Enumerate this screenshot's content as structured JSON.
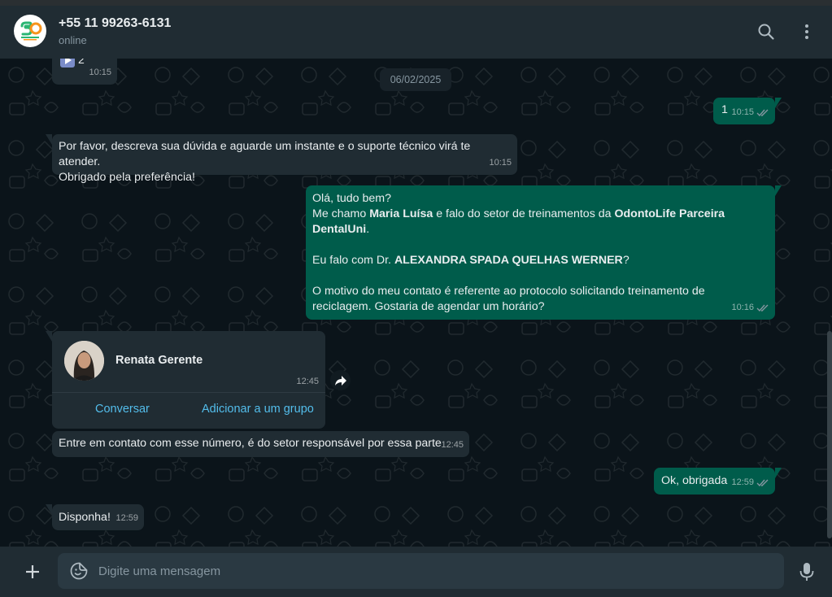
{
  "header": {
    "contact_name": "+55 11 99263-6131",
    "status": "online",
    "avatar_icon": "sd-logo-icon",
    "search_icon": "search-icon",
    "menu_icon": "kebab-menu-icon"
  },
  "chat": {
    "date_separator": "06/02/2025",
    "top_partial": {
      "option_number": "2",
      "option_icon": "play-icon",
      "time": "10:15"
    },
    "messages": [
      {
        "dir": "out",
        "text": "1",
        "time": "10:15",
        "status": "read"
      },
      {
        "dir": "in",
        "line1": "Por favor, descreva sua dúvida e aguarde um instante e o suporte técnico virá te atender.",
        "line2": "Obrigado pela preferência!",
        "time": "10:15"
      },
      {
        "dir": "out",
        "time": "10:16",
        "status": "read",
        "l1": "Olá, tudo bem?",
        "l2a": "Me chamo ",
        "l2b": "Maria Luísa",
        "l2c": " e falo do setor de treinamentos da ",
        "l2d": "OdontoLife Parceira",
        "l3a": "DentalUni",
        "l3b": ".",
        "l4a": "Eu falo com Dr. ",
        "l4b": "ALEXANDRA SPADA QUELHAS WERNER",
        "l4c": "?",
        "l5": "O motivo do meu contato é referente ao protocolo solicitando treinamento de",
        "l6": "reciclagem. Gostaria de agendar um horário?"
      },
      {
        "dir": "in",
        "type": "contact",
        "contact_name": "Renata Gerente",
        "time": "12:45",
        "action_chat": "Conversar",
        "action_group": "Adicionar a um grupo",
        "forward_icon": "forward-icon"
      },
      {
        "dir": "in",
        "text": "Entre em contato com esse número, é do setor responsável por essa parte",
        "time": "12:45"
      },
      {
        "dir": "out",
        "text": "Ok, obrigada",
        "time": "12:59",
        "status": "read"
      },
      {
        "dir": "in",
        "text": "Disponha!",
        "time": "12:59"
      }
    ]
  },
  "composer": {
    "attach_icon": "plus-icon",
    "emoji_icon": "sticker-emoji-icon",
    "placeholder": "Digite uma mensagem",
    "mic_icon": "microphone-icon"
  },
  "colors": {
    "incoming": "#202c33",
    "outgoing": "#005c4b",
    "background": "#0b141a",
    "link": "#53bdeb",
    "read_tick": "#8696a0"
  }
}
